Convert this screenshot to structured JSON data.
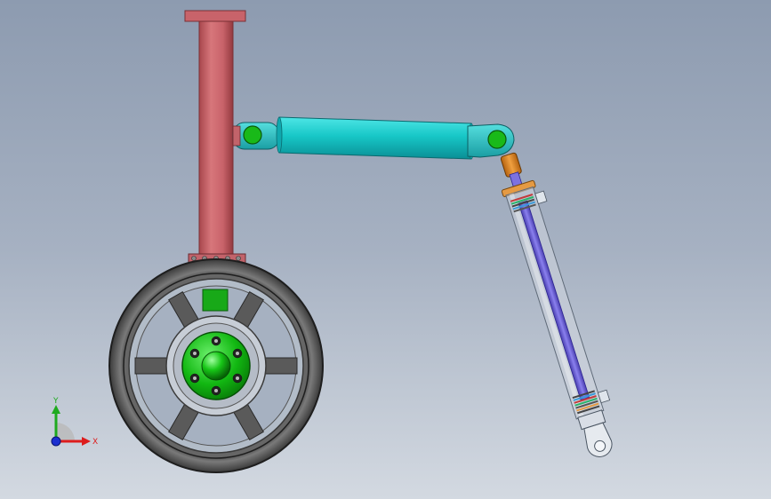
{
  "viewport": {
    "background_top": "#8d9bb0",
    "background_bottom": "#d3d9e1"
  },
  "model": {
    "parts": [
      {
        "name": "strut-column",
        "color": "#cd6b70"
      },
      {
        "name": "strut-top-flange",
        "color": "#cd6b70"
      },
      {
        "name": "drag-brace-actuator",
        "color": "#15c8c8"
      },
      {
        "name": "pivot-pin",
        "color": "#18b818"
      },
      {
        "name": "shock-absorber-cylinder",
        "color": "#c7ced8"
      },
      {
        "name": "shock-absorber-piston-rod",
        "color": "#6a5dd0"
      },
      {
        "name": "rod-end-coupling",
        "color": "#d98520"
      },
      {
        "name": "wheel-tire",
        "color": "#4a4a4a"
      },
      {
        "name": "wheel-hub",
        "color": "#19c019"
      }
    ]
  },
  "triad": {
    "x_label": "X",
    "y_label": "Y",
    "x_color": "#dd1c1c",
    "y_color": "#1faa1f",
    "z_color": "#1c2fd0"
  }
}
